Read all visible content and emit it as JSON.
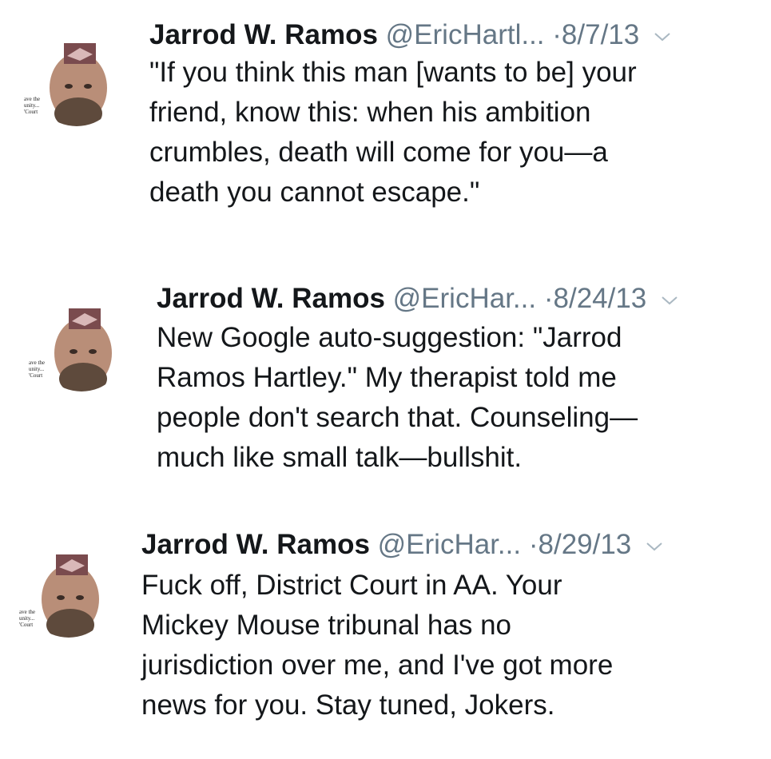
{
  "tweets": [
    {
      "name": "Jarrod W. Ramos",
      "handle": "@EricHartl...",
      "separator": "·",
      "date": "8/7/13",
      "avatar_caption": "ave the\nunity...\n'Court",
      "text": "\"If you think this man [wants to be] your\nfriend, know this: when his ambition\ncrumbles, death will come for you—a\ndeath you cannot escape.\""
    },
    {
      "name": "Jarrod W. Ramos",
      "handle": "@EricHar...",
      "separator": "·",
      "date": "8/24/13",
      "avatar_caption": "ave the\nunity...\n'Court",
      "text": "New Google auto-suggestion: \"Jarrod\nRamos Hartley.\" My therapist told me\npeople don't search that. Counseling—\nmuch like small talk—bullshit."
    },
    {
      "name": "Jarrod W. Ramos",
      "handle": "@EricHar...",
      "separator": "·",
      "date": "8/29/13",
      "avatar_caption": "ave the\nunity...\n'Court",
      "text": "Fuck off, District Court in AA. Your\nMickey Mouse tribunal has no\njurisdiction over me, and I've got more\nnews for you. Stay tuned, Jokers."
    }
  ],
  "icons": {
    "menu": "chevron-down-icon",
    "avatar": "user-avatar"
  },
  "colors": {
    "text": "#14171a",
    "secondary": "#657786",
    "background": "#ffffff"
  }
}
